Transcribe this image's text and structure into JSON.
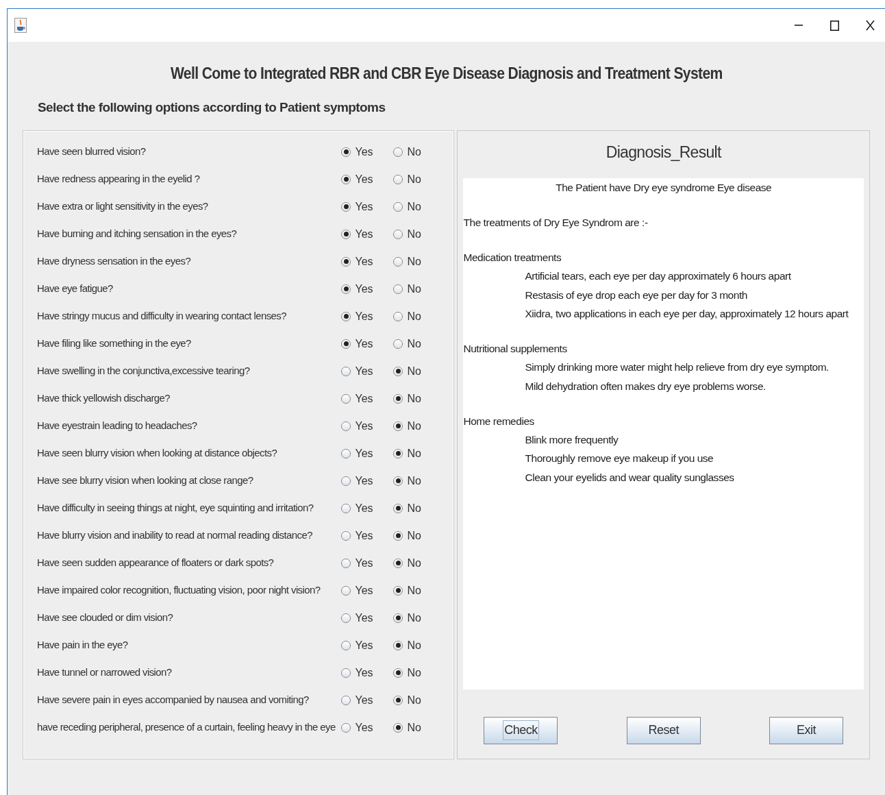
{
  "window": {
    "controls": [
      {
        "kind": "minimize"
      },
      {
        "kind": "maximize"
      },
      {
        "kind": "close"
      }
    ]
  },
  "title": "Well Come to Integrated RBR and CBR Eye Disease Diagnosis and Treatment System",
  "subtitle": "Select the following options according to Patient symptoms",
  "questions": [
    {
      "text": "Have seen blurred vision?",
      "options": [
        {
          "label": "Yes",
          "selected": true
        },
        {
          "label": "No",
          "selected": false
        }
      ]
    },
    {
      "text": "Have redness appearing in the eyelid ?",
      "options": [
        {
          "label": "Yes",
          "selected": true
        },
        {
          "label": "No",
          "selected": false
        }
      ]
    },
    {
      "text": "Have extra or light sensitivity in the eyes?",
      "options": [
        {
          "label": "Yes",
          "selected": true
        },
        {
          "label": "No",
          "selected": false
        }
      ]
    },
    {
      "text": "Have burning and itching sensation in the eyes?",
      "options": [
        {
          "label": "Yes",
          "selected": true
        },
        {
          "label": "No",
          "selected": false
        }
      ]
    },
    {
      "text": "Have dryness sensation in the eyes?",
      "options": [
        {
          "label": "Yes",
          "selected": true
        },
        {
          "label": "No",
          "selected": false
        }
      ]
    },
    {
      "text": "Have eye fatigue?",
      "options": [
        {
          "label": "Yes",
          "selected": true
        },
        {
          "label": "No",
          "selected": false
        }
      ]
    },
    {
      "text": "Have stringy mucus and difficulty in wearing contact lenses?",
      "options": [
        {
          "label": "Yes",
          "selected": true
        },
        {
          "label": "No",
          "selected": false
        }
      ]
    },
    {
      "text": "Have filing like something in the eye?",
      "options": [
        {
          "label": "Yes",
          "selected": true
        },
        {
          "label": "No",
          "selected": false
        }
      ]
    },
    {
      "text": "Have swelling in the conjunctiva,excessive tearing?",
      "options": [
        {
          "label": "Yes",
          "selected": false
        },
        {
          "label": "No",
          "selected": true
        }
      ]
    },
    {
      "text": "Have thick yellowish discharge?",
      "options": [
        {
          "label": "Yes",
          "selected": false
        },
        {
          "label": "No",
          "selected": true
        }
      ]
    },
    {
      "text": "Have eyestrain leading to headaches?",
      "options": [
        {
          "label": "Yes",
          "selected": false
        },
        {
          "label": "No",
          "selected": true
        }
      ]
    },
    {
      "text": "Have seen blurry vision when looking at distance objects?",
      "options": [
        {
          "label": "Yes",
          "selected": false
        },
        {
          "label": "No",
          "selected": true
        }
      ]
    },
    {
      "text": "Have see blurry vision when looking at close range?",
      "options": [
        {
          "label": "Yes",
          "selected": false
        },
        {
          "label": "No",
          "selected": true
        }
      ]
    },
    {
      "text": "Have difficulty in seeing things at night, eye squinting and irritation?",
      "options": [
        {
          "label": "Yes",
          "selected": false
        },
        {
          "label": "No",
          "selected": true
        }
      ]
    },
    {
      "text": "Have blurry vision and inability to read at normal reading distance?",
      "options": [
        {
          "label": "Yes",
          "selected": false
        },
        {
          "label": "No",
          "selected": true
        }
      ]
    },
    {
      "text": "Have seen sudden appearance of floaters or dark spots?",
      "options": [
        {
          "label": "Yes",
          "selected": false
        },
        {
          "label": "No",
          "selected": true
        }
      ]
    },
    {
      "text": "Have impaired color recognition, fluctuating vision, poor night vision?",
      "options": [
        {
          "label": "Yes",
          "selected": false
        },
        {
          "label": "No",
          "selected": true
        }
      ]
    },
    {
      "text": "Have see clouded or dim vision?",
      "options": [
        {
          "label": "Yes",
          "selected": false
        },
        {
          "label": "No",
          "selected": true
        }
      ]
    },
    {
      "text": "Have pain in the eye?",
      "options": [
        {
          "label": "Yes",
          "selected": false
        },
        {
          "label": "No",
          "selected": true
        }
      ]
    },
    {
      "text": "Have tunnel or narrowed vision?",
      "options": [
        {
          "label": "Yes",
          "selected": false
        },
        {
          "label": "No",
          "selected": true
        }
      ]
    },
    {
      "text": "Have severe pain in eyes accompanied by nausea and vomiting?",
      "options": [
        {
          "label": "Yes",
          "selected": false
        },
        {
          "label": "No",
          "selected": true
        }
      ]
    },
    {
      "text": "have receding peripheral,  presence of a curtain, feeling heavy in the eye",
      "options": [
        {
          "label": "Yes",
          "selected": false
        },
        {
          "label": "No",
          "selected": true
        }
      ]
    }
  ],
  "result": {
    "title": "Diagnosis_Result",
    "diagnosis": "The Patient have Dry eye syndrome Eye disease",
    "intro": "The treatments of Dry Eye Syndrom are :-",
    "sections": [
      {
        "heading": "Medication treatments",
        "items": [
          "Artificial tears, each eye per day approximately 6 hours apart",
          "Restasis of eye drop each eye per day for 3 month",
          "Xiidra, two applications in each eye per day, approximately 12 hours apart"
        ]
      },
      {
        "heading": "Nutritional supplements",
        "items": [
          "Simply drinking more water might help relieve from dry eye symptom.",
          "Mild dehydration often makes dry eye problems worse."
        ]
      },
      {
        "heading": "Home remedies",
        "items": [
          "Blink more frequently",
          "Thoroughly remove eye makeup if you use",
          "Clean your eyelids and wear quality sunglasses"
        ]
      }
    ]
  },
  "buttons": [
    {
      "label": "Check",
      "focused": true
    },
    {
      "label": "Reset",
      "focused": false
    },
    {
      "label": "Exit",
      "focused": false
    }
  ]
}
